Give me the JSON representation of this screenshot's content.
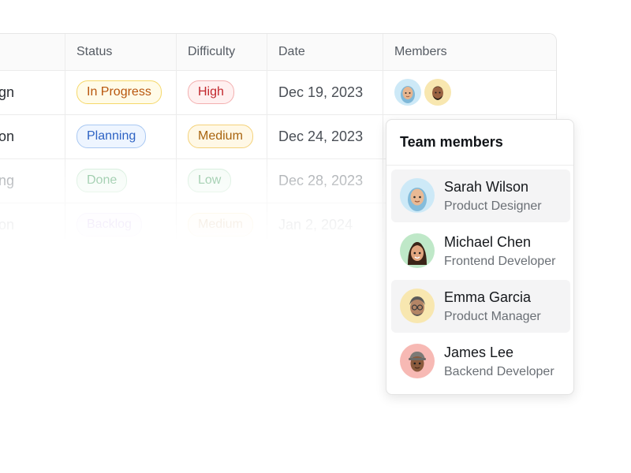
{
  "table": {
    "headers": {
      "status": "Status",
      "difficulty": "Difficulty",
      "date": "Date",
      "members": "Members"
    },
    "rows": [
      {
        "name": "gn",
        "status": "In Progress",
        "difficulty": "High",
        "date": "Dec 19, 2023"
      },
      {
        "name": "egration",
        "status": "Planning",
        "difficulty": "Medium",
        "date": "Dec 24, 2023"
      },
      {
        "name": "esting",
        "status": "Done",
        "difficulty": "Low",
        "date": "Dec 28, 2023"
      },
      {
        "name": "entation",
        "status": "Backlog",
        "difficulty": "Medium",
        "date": "Jan 2, 2024"
      }
    ]
  },
  "popover": {
    "title": "Team members",
    "members": [
      {
        "name": "Sarah Wilson",
        "role": "Product Designer",
        "avatar_bg": "#cde9f7",
        "highlighted": true
      },
      {
        "name": "Michael Chen",
        "role": "Frontend Developer",
        "avatar_bg": "#bfe8c8",
        "highlighted": false
      },
      {
        "name": "Emma Garcia",
        "role": "Product Manager",
        "avatar_bg": "#f8e7b0",
        "highlighted": true
      },
      {
        "name": "James Lee",
        "role": "Backend Developer",
        "avatar_bg": "#f7b9b4",
        "highlighted": false
      }
    ]
  },
  "colors": {
    "status_in_progress": "#b8560d",
    "status_planning": "#2e63c4",
    "status_done": "#3d9a5a",
    "status_backlog": "#8a55d6",
    "difficulty_high": "#c2272d",
    "difficulty_medium": "#a8640f",
    "difficulty_low": "#3d9a5a"
  },
  "icons": {
    "avatar": "memoji-avatar-icon"
  }
}
